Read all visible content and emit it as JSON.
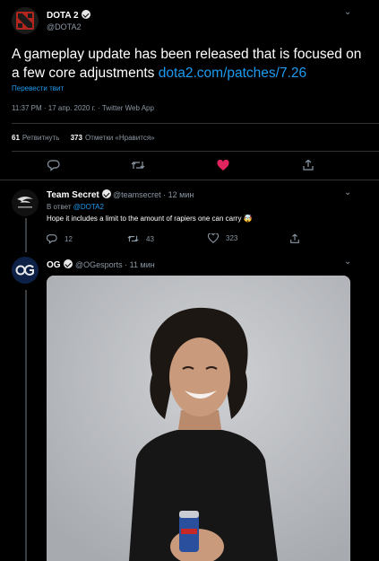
{
  "main_tweet": {
    "author_name": "DOTA 2",
    "author_handle": "@DOTA2",
    "text": "A gameplay update has been released that is focused on a few core adjustments",
    "link": "dota2.com/patches/7.26",
    "translate_label": "Перевести твит",
    "timestamp": "11:37 PM · 17 апр. 2020 г. · Twitter Web App",
    "retweets_count": "61",
    "retweets_label": "Ретвитнуть",
    "likes_count": "373",
    "likes_label": "Отметки «Нравится»",
    "liked": true,
    "like_color": "#e0245e",
    "link_color": "#1d9bf0"
  },
  "replies": [
    {
      "author_name": "Team Secret",
      "author_handle": "@teamsecret",
      "time": "12 мин",
      "reply_to_prefix": "В ответ",
      "reply_to_handle": "@DOTA2",
      "text": "Hope it includes a limit to the amount of rapiers one can carry",
      "emoji": "🤯",
      "replies_count": "12",
      "retweets_count": "43",
      "likes_count": "323"
    },
    {
      "author_name": "OG",
      "author_handle": "@OGesports",
      "time": "11 мин"
    }
  ]
}
